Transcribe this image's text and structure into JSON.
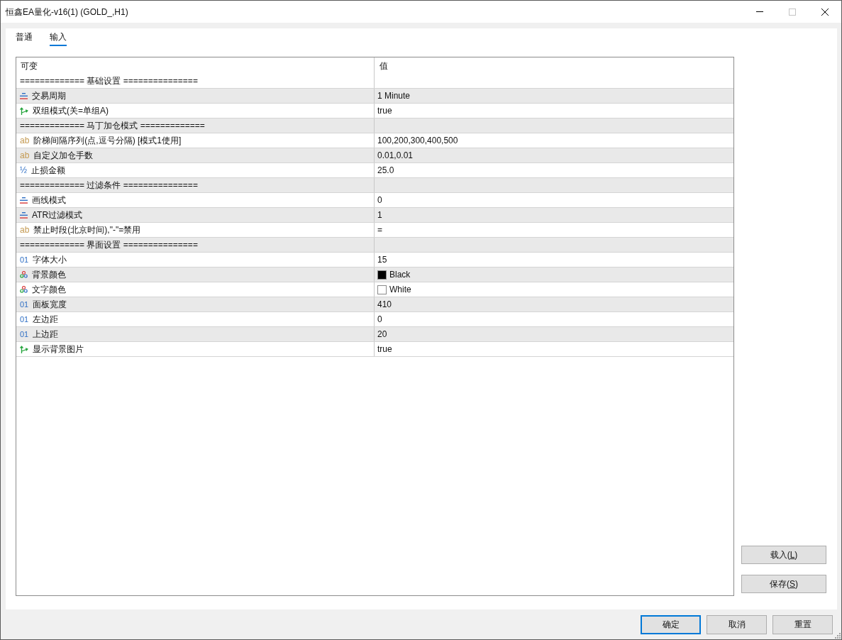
{
  "window": {
    "title": "恒鑫EA量化-v16(1) (GOLD_,H1)",
    "controls": [
      {
        "kind": "minimize",
        "disabled": false
      },
      {
        "kind": "maximize",
        "disabled": true
      },
      {
        "kind": "close",
        "disabled": false
      }
    ]
  },
  "tabs": [
    {
      "label": "普通",
      "selected": false
    },
    {
      "label": "输入",
      "selected": true
    }
  ],
  "table": {
    "columns": [
      "可变",
      "值"
    ],
    "rows": [
      {
        "kind": "section",
        "name": "============= 基础设置 ==============="
      },
      {
        "kind": "enum",
        "name": "交易周期",
        "value": "1 Minute"
      },
      {
        "kind": "bool",
        "name": "双组模式(关=单组A)",
        "value": "true"
      },
      {
        "kind": "section",
        "name": "============= 马丁加仓模式 ============="
      },
      {
        "kind": "string",
        "glyph": "ab",
        "name": "阶梯间隔序列(点,逗号分隔) [模式1使用]",
        "value": "100,200,300,400,500"
      },
      {
        "kind": "string",
        "glyph": "ab",
        "name": "自定义加仓手数",
        "value": "0.01,0.01"
      },
      {
        "kind": "double",
        "glyph": "½",
        "name": "止损金额",
        "value": "25.0"
      },
      {
        "kind": "section",
        "name": "============= 过滤条件 ==============="
      },
      {
        "kind": "enum",
        "name": "画线模式",
        "value": "0"
      },
      {
        "kind": "enum",
        "name": "ATR过滤模式",
        "value": "1"
      },
      {
        "kind": "string",
        "glyph": "ab",
        "name": "禁止时段(北京时间),\"-\"=禁用",
        "value": "="
      },
      {
        "kind": "section",
        "name": "============= 界面设置 ==============="
      },
      {
        "kind": "int",
        "glyph": "01",
        "name": "字体大小",
        "value": "15"
      },
      {
        "kind": "color",
        "name": "背景颜色",
        "value": "Black",
        "color": "#000000"
      },
      {
        "kind": "color",
        "name": "文字颜色",
        "value": "White",
        "color": "#ffffff"
      },
      {
        "kind": "int",
        "glyph": "01",
        "name": "面板宽度",
        "value": "410"
      },
      {
        "kind": "int",
        "glyph": "01",
        "name": "左边距",
        "value": "0"
      },
      {
        "kind": "int",
        "glyph": "01",
        "name": "上边距",
        "value": "20"
      },
      {
        "kind": "bool",
        "name": "显示背景图片",
        "value": "true"
      }
    ]
  },
  "side_buttons": [
    {
      "label": "载入(",
      "accesskey": "L",
      "label_end": ")"
    },
    {
      "label": "保存(",
      "accesskey": "S",
      "label_end": ")"
    }
  ],
  "footer_buttons": [
    {
      "label": "确定",
      "focused": true
    },
    {
      "label": "取消",
      "focused": false
    },
    {
      "label": "重置",
      "focused": false
    }
  ]
}
